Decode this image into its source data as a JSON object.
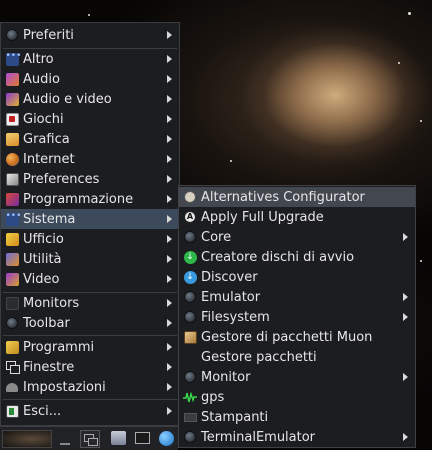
{
  "main_menu": {
    "items": [
      {
        "label": "Preferiti",
        "icon": "favorites-icon"
      },
      {
        "label": "Altro",
        "icon": "other-icon"
      },
      {
        "label": "Audio",
        "icon": "audio-icon"
      },
      {
        "label": "Audio e video",
        "icon": "multimedia-icon"
      },
      {
        "label": "Giochi",
        "icon": "games-icon"
      },
      {
        "label": "Grafica",
        "icon": "graphics-icon"
      },
      {
        "label": "Internet",
        "icon": "internet-icon"
      },
      {
        "label": "Preferences",
        "icon": "preferences-icon"
      },
      {
        "label": "Programmazione",
        "icon": "development-icon"
      },
      {
        "label": "Sistema",
        "icon": "system-icon"
      },
      {
        "label": "Ufficio",
        "icon": "office-icon"
      },
      {
        "label": "Utilità",
        "icon": "utilities-icon"
      },
      {
        "label": "Video",
        "icon": "video-icon"
      },
      {
        "label": "Monitors",
        "icon": "monitors-icon"
      },
      {
        "label": "Toolbar",
        "icon": "toolbar-icon"
      },
      {
        "label": "Programmi",
        "icon": "programs-icon"
      },
      {
        "label": "Finestre",
        "icon": "windows-icon"
      },
      {
        "label": "Impostazioni",
        "icon": "settings-icon"
      },
      {
        "label": "Esci...",
        "icon": "exit-icon"
      }
    ]
  },
  "system_submenu": {
    "items": [
      {
        "label": "Alternatives Configurator",
        "icon": "alternatives-icon"
      },
      {
        "label": "Apply Full Upgrade",
        "icon": "upgrade-icon"
      },
      {
        "label": "Core",
        "icon": "core-icon"
      },
      {
        "label": "Creatore dischi di avvio",
        "icon": "startup-disk-icon"
      },
      {
        "label": "Discover",
        "icon": "discover-icon"
      },
      {
        "label": "Emulator",
        "icon": "emulator-icon"
      },
      {
        "label": "Filesystem",
        "icon": "filesystem-icon"
      },
      {
        "label": "Gestore di pacchetti Muon",
        "icon": "muon-icon"
      },
      {
        "label": "Gestore pacchetti",
        "icon": "package-manager-icon"
      },
      {
        "label": "Monitor",
        "icon": "monitor-icon"
      },
      {
        "label": "gps",
        "icon": "gps-icon"
      },
      {
        "label": "Stampanti",
        "icon": "printer-icon"
      },
      {
        "label": "TerminalEmulator",
        "icon": "terminal-emulator-icon"
      }
    ]
  },
  "colors": {
    "menu_bg": "#1c1d20",
    "active_item": "#3d4a5c",
    "text": "#e6e6e6"
  }
}
